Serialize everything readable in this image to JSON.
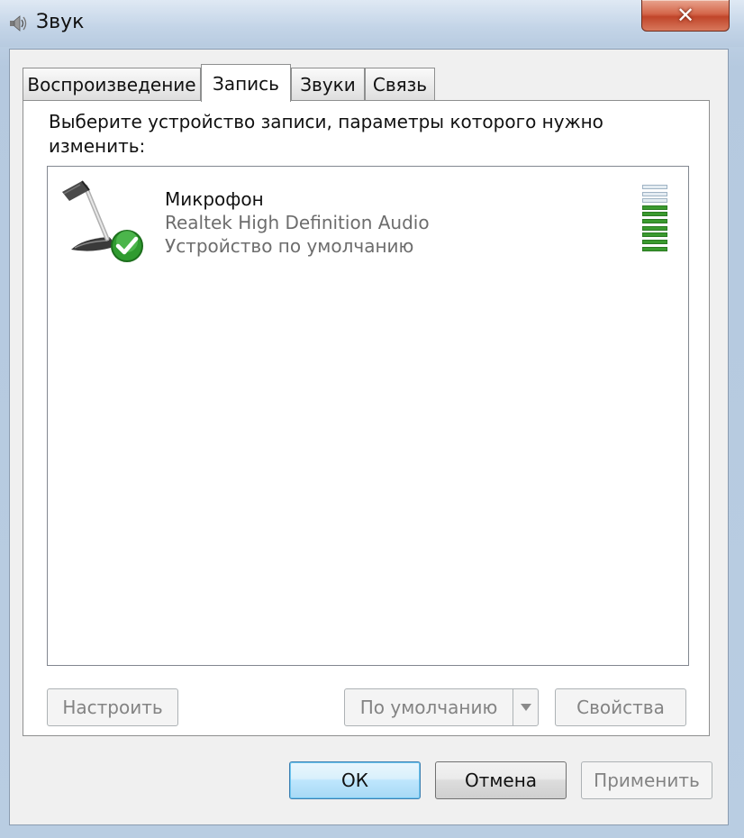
{
  "window": {
    "title": "Звук",
    "close_symbol": "✕"
  },
  "tabs": [
    {
      "label": "Воспроизведение",
      "active": false
    },
    {
      "label": "Запись",
      "active": true
    },
    {
      "label": "Звуки",
      "active": false
    },
    {
      "label": "Связь",
      "active": false
    }
  ],
  "panel": {
    "instruction": "Выберите устройство записи, параметры которого нужно изменить:"
  },
  "devices": [
    {
      "name": "Микрофон",
      "driver": "Realtek High Definition Audio",
      "status": "Устройство по умолчанию",
      "icon": "microphone-icon",
      "default_badge_icon": "check-icon",
      "level_segments_total": 10,
      "level_segments_lit": 7,
      "level_color": "#3a9a2e"
    }
  ],
  "panel_buttons": {
    "configure": "Настроить",
    "set_default": "По умолчанию",
    "properties": "Свойства"
  },
  "dialog_buttons": {
    "ok": "ОК",
    "cancel": "Отмена",
    "apply": "Применить"
  }
}
